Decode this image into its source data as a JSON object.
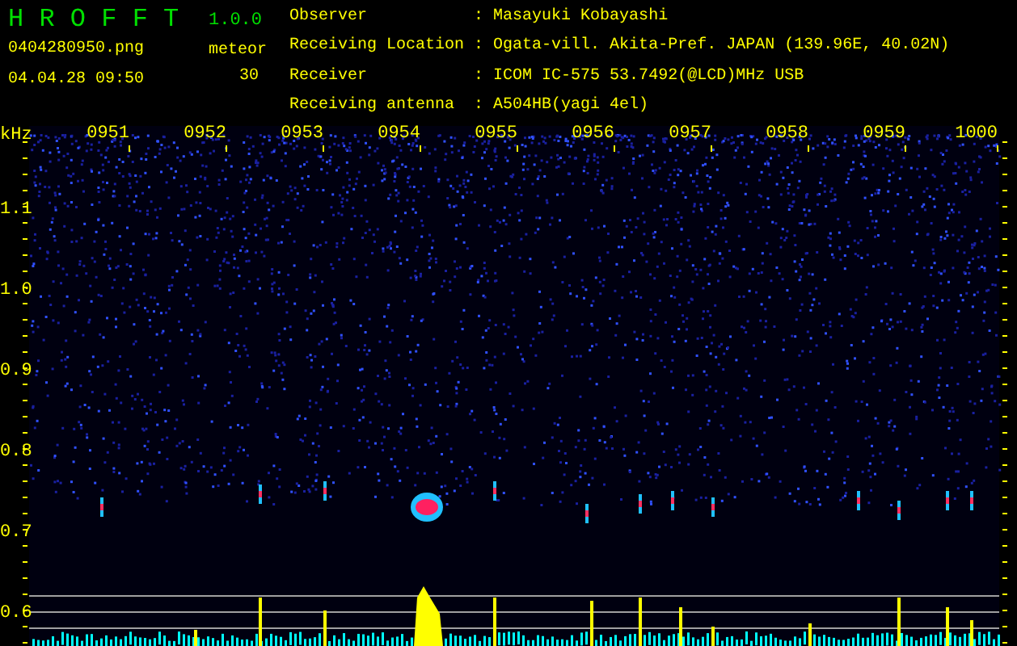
{
  "app": {
    "title": "H R O F F T",
    "version": "1.0.0"
  },
  "file": {
    "name": "0404280950.png",
    "timestamp": "04.04.28 09:50"
  },
  "counter": {
    "label": "meteor",
    "value": "30"
  },
  "station_info": [
    {
      "label": "Observer",
      "separator": ":",
      "value": "Masayuki Kobayashi"
    },
    {
      "label": "Receiving Location",
      "separator": ":",
      "value": "Ogata-vill. Akita-Pref. JAPAN (139.96E, 40.02N)"
    },
    {
      "label": "Receiver",
      "separator": ":",
      "value": "ICOM IC-575 53.7492(@LCD)MHz USB"
    },
    {
      "label": "Receiving antenna",
      "separator": ":",
      "value": "A504HB(yagi 4el)"
    }
  ],
  "spectrogram": {
    "frequency_unit": "kHz",
    "time_labels": [
      "0951",
      "0952",
      "0953",
      "0954",
      "0955",
      "0956",
      "0957",
      "0958",
      "0959",
      "1000"
    ],
    "frequency_labels": [
      "1.1",
      "1.0",
      "0.9",
      "0.8",
      "0.7",
      "0.6"
    ]
  }
}
